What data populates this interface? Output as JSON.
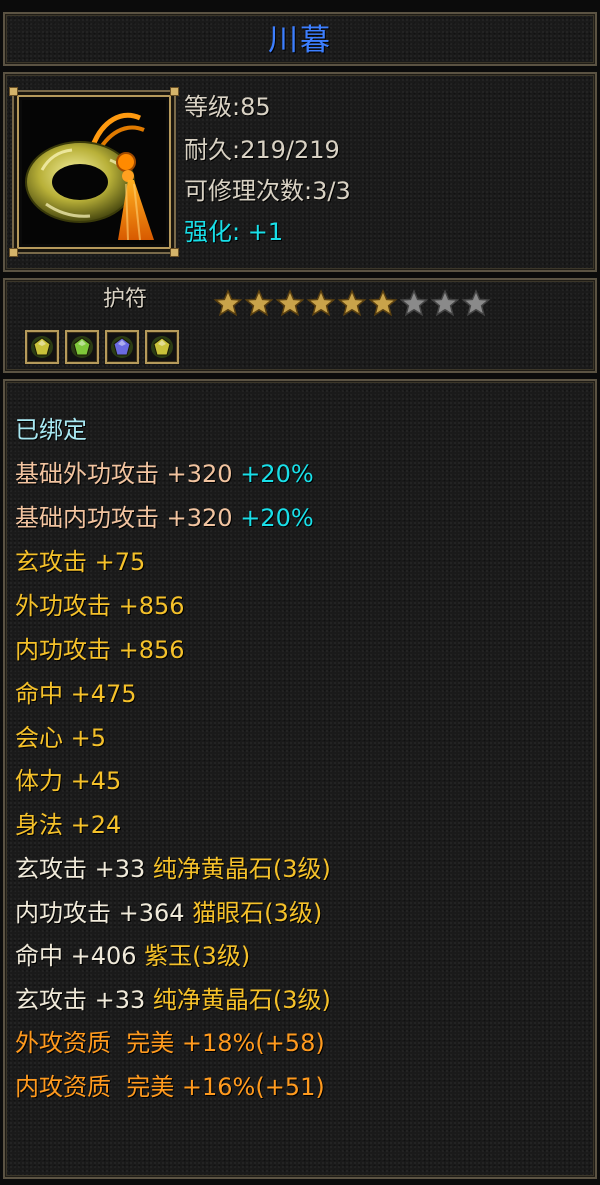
{
  "item": {
    "name": "川暮",
    "level": "等级:85",
    "durability": "耐久:219/219",
    "repairs": "可修理次数:3/3",
    "enhance": "强化: +1",
    "type": "护符",
    "stars": {
      "filled": 6,
      "total": 9
    },
    "colors": {
      "star_filled": "#c9a34a",
      "star_empty": "#8a8a8a",
      "title": "#3d7fff"
    }
  },
  "gems": [
    {
      "icon": "yellow-crystal-gem-icon",
      "color": "#c8c23a"
    },
    {
      "icon": "cat-eye-gem-icon",
      "color": "#7fc83a"
    },
    {
      "icon": "purple-jade-gem-icon",
      "color": "#6a6adf"
    },
    {
      "icon": "yellow-crystal-gem-icon",
      "color": "#c8c23a"
    }
  ],
  "stats": {
    "bound": "已绑定",
    "base_outer": {
      "text": "基础外功攻击 +320",
      "pct": "+20%"
    },
    "base_inner": {
      "text": "基础内功攻击 +320",
      "pct": "+20%"
    },
    "lines": [
      "玄攻击 +75",
      "外功攻击 +856",
      "内功攻击 +856",
      "命中 +475",
      "会心 +5",
      "体力 +45",
      "身法 +24"
    ],
    "gem_lines": [
      {
        "stat": "玄攻击 +33",
        "gem": "纯净黄晶石(3级)"
      },
      {
        "stat": "内功攻击 +364",
        "gem": "猫眼石(3级)"
      },
      {
        "stat": "命中 +406",
        "gem": "紫玉(3级)"
      },
      {
        "stat": "玄攻击 +33",
        "gem": "纯净黄晶石(3级)"
      }
    ],
    "quality_lines": [
      "外攻资质  完美 +18%(+58)",
      "内攻资质  完美 +16%(+51)"
    ]
  }
}
